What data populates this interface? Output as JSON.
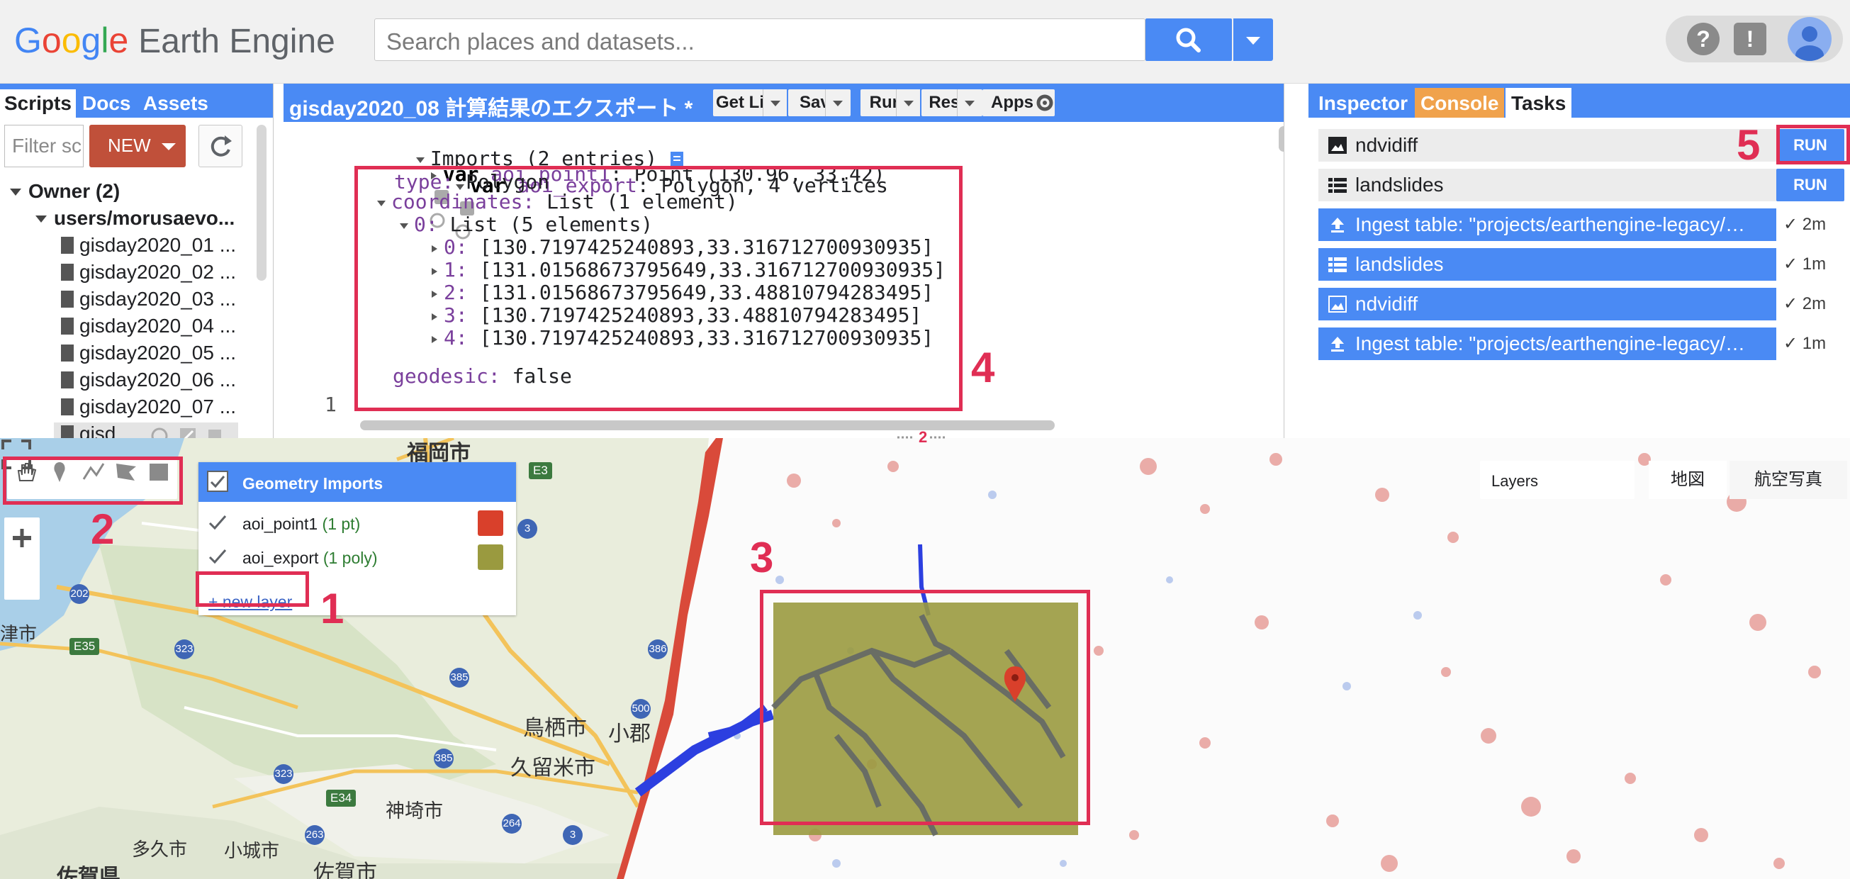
{
  "header": {
    "logo_letters": [
      "G",
      "o",
      "o",
      "g",
      "l",
      "e"
    ],
    "product": "Earth Engine",
    "search_placeholder": "Search places and datasets...",
    "icons": [
      "search-icon",
      "caret-down-icon",
      "help-icon",
      "feedback-icon",
      "account-icon"
    ]
  },
  "left_panel": {
    "tabs": [
      "Scripts",
      "Docs",
      "Assets"
    ],
    "active_tab": "Scripts",
    "filter_placeholder": "Filter sc",
    "new_button": "NEW",
    "tree": {
      "owner": "Owner",
      "owner_count": "(2)",
      "user": "users/morusaevo...",
      "files": [
        "gisday2020_01 ...",
        "gisday2020_02 ...",
        "gisday2020_03 ...",
        "gisday2020_04 ...",
        "gisday2020_05 ...",
        "gisday2020_06 ...",
        "gisday2020_07 ...",
        "gisd..."
      ]
    }
  },
  "editor": {
    "title": "gisday2020_08 計算結果のエクスポート *",
    "buttons": {
      "get_link": "Get Link",
      "save": "Save",
      "run": "Run",
      "reset": "Reset",
      "apps": "Apps"
    },
    "code": {
      "imports": "Imports (2 entries)",
      "line1_kw": "var",
      "line1_name": "aoi_point1",
      "line1_rest": ": Point (130.96, 33.42)",
      "line2_kw": "var",
      "line2_name": "aoi_export",
      "line2_rest": ": Polygon, 4 vertices",
      "type_key": "type:",
      "type_val": " Polygon",
      "coords_key": "coordinates:",
      "coords_val": " List (1 element)",
      "list_key": "0:",
      "list_val": " List (5 elements)",
      "rows": [
        {
          "k": "0:",
          "v": " [130.7197425240893,33.316712700930935]"
        },
        {
          "k": "1:",
          "v": " [131.01568673795649,33.316712700930935]"
        },
        {
          "k": "2:",
          "v": " [131.01568673795649,33.48810794283495]"
        },
        {
          "k": "3:",
          "v": " [130.7197425240893,33.48810794283495]"
        },
        {
          "k": "4:",
          "v": " [130.7197425240893,33.316712700930935]"
        }
      ],
      "geodesic_key": "geodesic:",
      "geodesic_val": " false",
      "line_number": "1"
    }
  },
  "right_panel": {
    "tabs": [
      "Inspector",
      "Console",
      "Tasks"
    ],
    "active_tab": "Tasks",
    "pending_tasks": [
      {
        "name": "ndvidiff",
        "action": "RUN",
        "icon": "image-icon"
      },
      {
        "name": "landslides",
        "action": "RUN",
        "icon": "table-icon"
      }
    ],
    "completed_tasks": [
      {
        "name": "Ingest table: \"projects/earthengine-legacy/…",
        "time": "2m",
        "icon": "upload-icon"
      },
      {
        "name": "landslides",
        "time": "1m",
        "icon": "table-icon"
      },
      {
        "name": "ndvidiff",
        "time": "2m",
        "icon": "image-icon"
      },
      {
        "name": "Ingest table: \"projects/earthengine-legacy/…",
        "time": "1m",
        "icon": "upload-icon"
      }
    ]
  },
  "map": {
    "geometry_imports": {
      "title": "Geometry Imports",
      "layers": [
        {
          "name": "aoi_point1",
          "count": "(1 pt)",
          "color": "#d9402b"
        },
        {
          "name": "aoi_export",
          "count": "(1 poly)",
          "color": "#9a9a3f"
        }
      ],
      "new_layer": "+ new layer"
    },
    "layers_label": "Layers",
    "map_types": [
      "地図",
      "航空写真"
    ],
    "place_labels": [
      "福岡市",
      "鳥栖市",
      "小郡",
      "久留米市",
      "神埼市",
      "佐賀市",
      "小城市",
      "多久市",
      "佐賀県",
      "津市"
    ],
    "road_labels": [
      "E3",
      "3",
      "202",
      "E35",
      "323",
      "385",
      "386",
      "500",
      "385",
      "323",
      "E34",
      "264",
      "263",
      "3"
    ],
    "tool_icons": [
      "hand-icon",
      "marker-icon",
      "line-icon",
      "polygon-icon",
      "rectangle-icon"
    ],
    "marker_icon": "map-marker-icon",
    "divider_count": "2"
  },
  "annotations": [
    "1",
    "2",
    "3",
    "4",
    "5"
  ],
  "colors": {
    "accent": "#4a8af4",
    "new_button": "#c0503a",
    "console_tab": "#f0a24c",
    "annotation": "#e02e54",
    "polygon_fill": "#9a9a3f"
  }
}
